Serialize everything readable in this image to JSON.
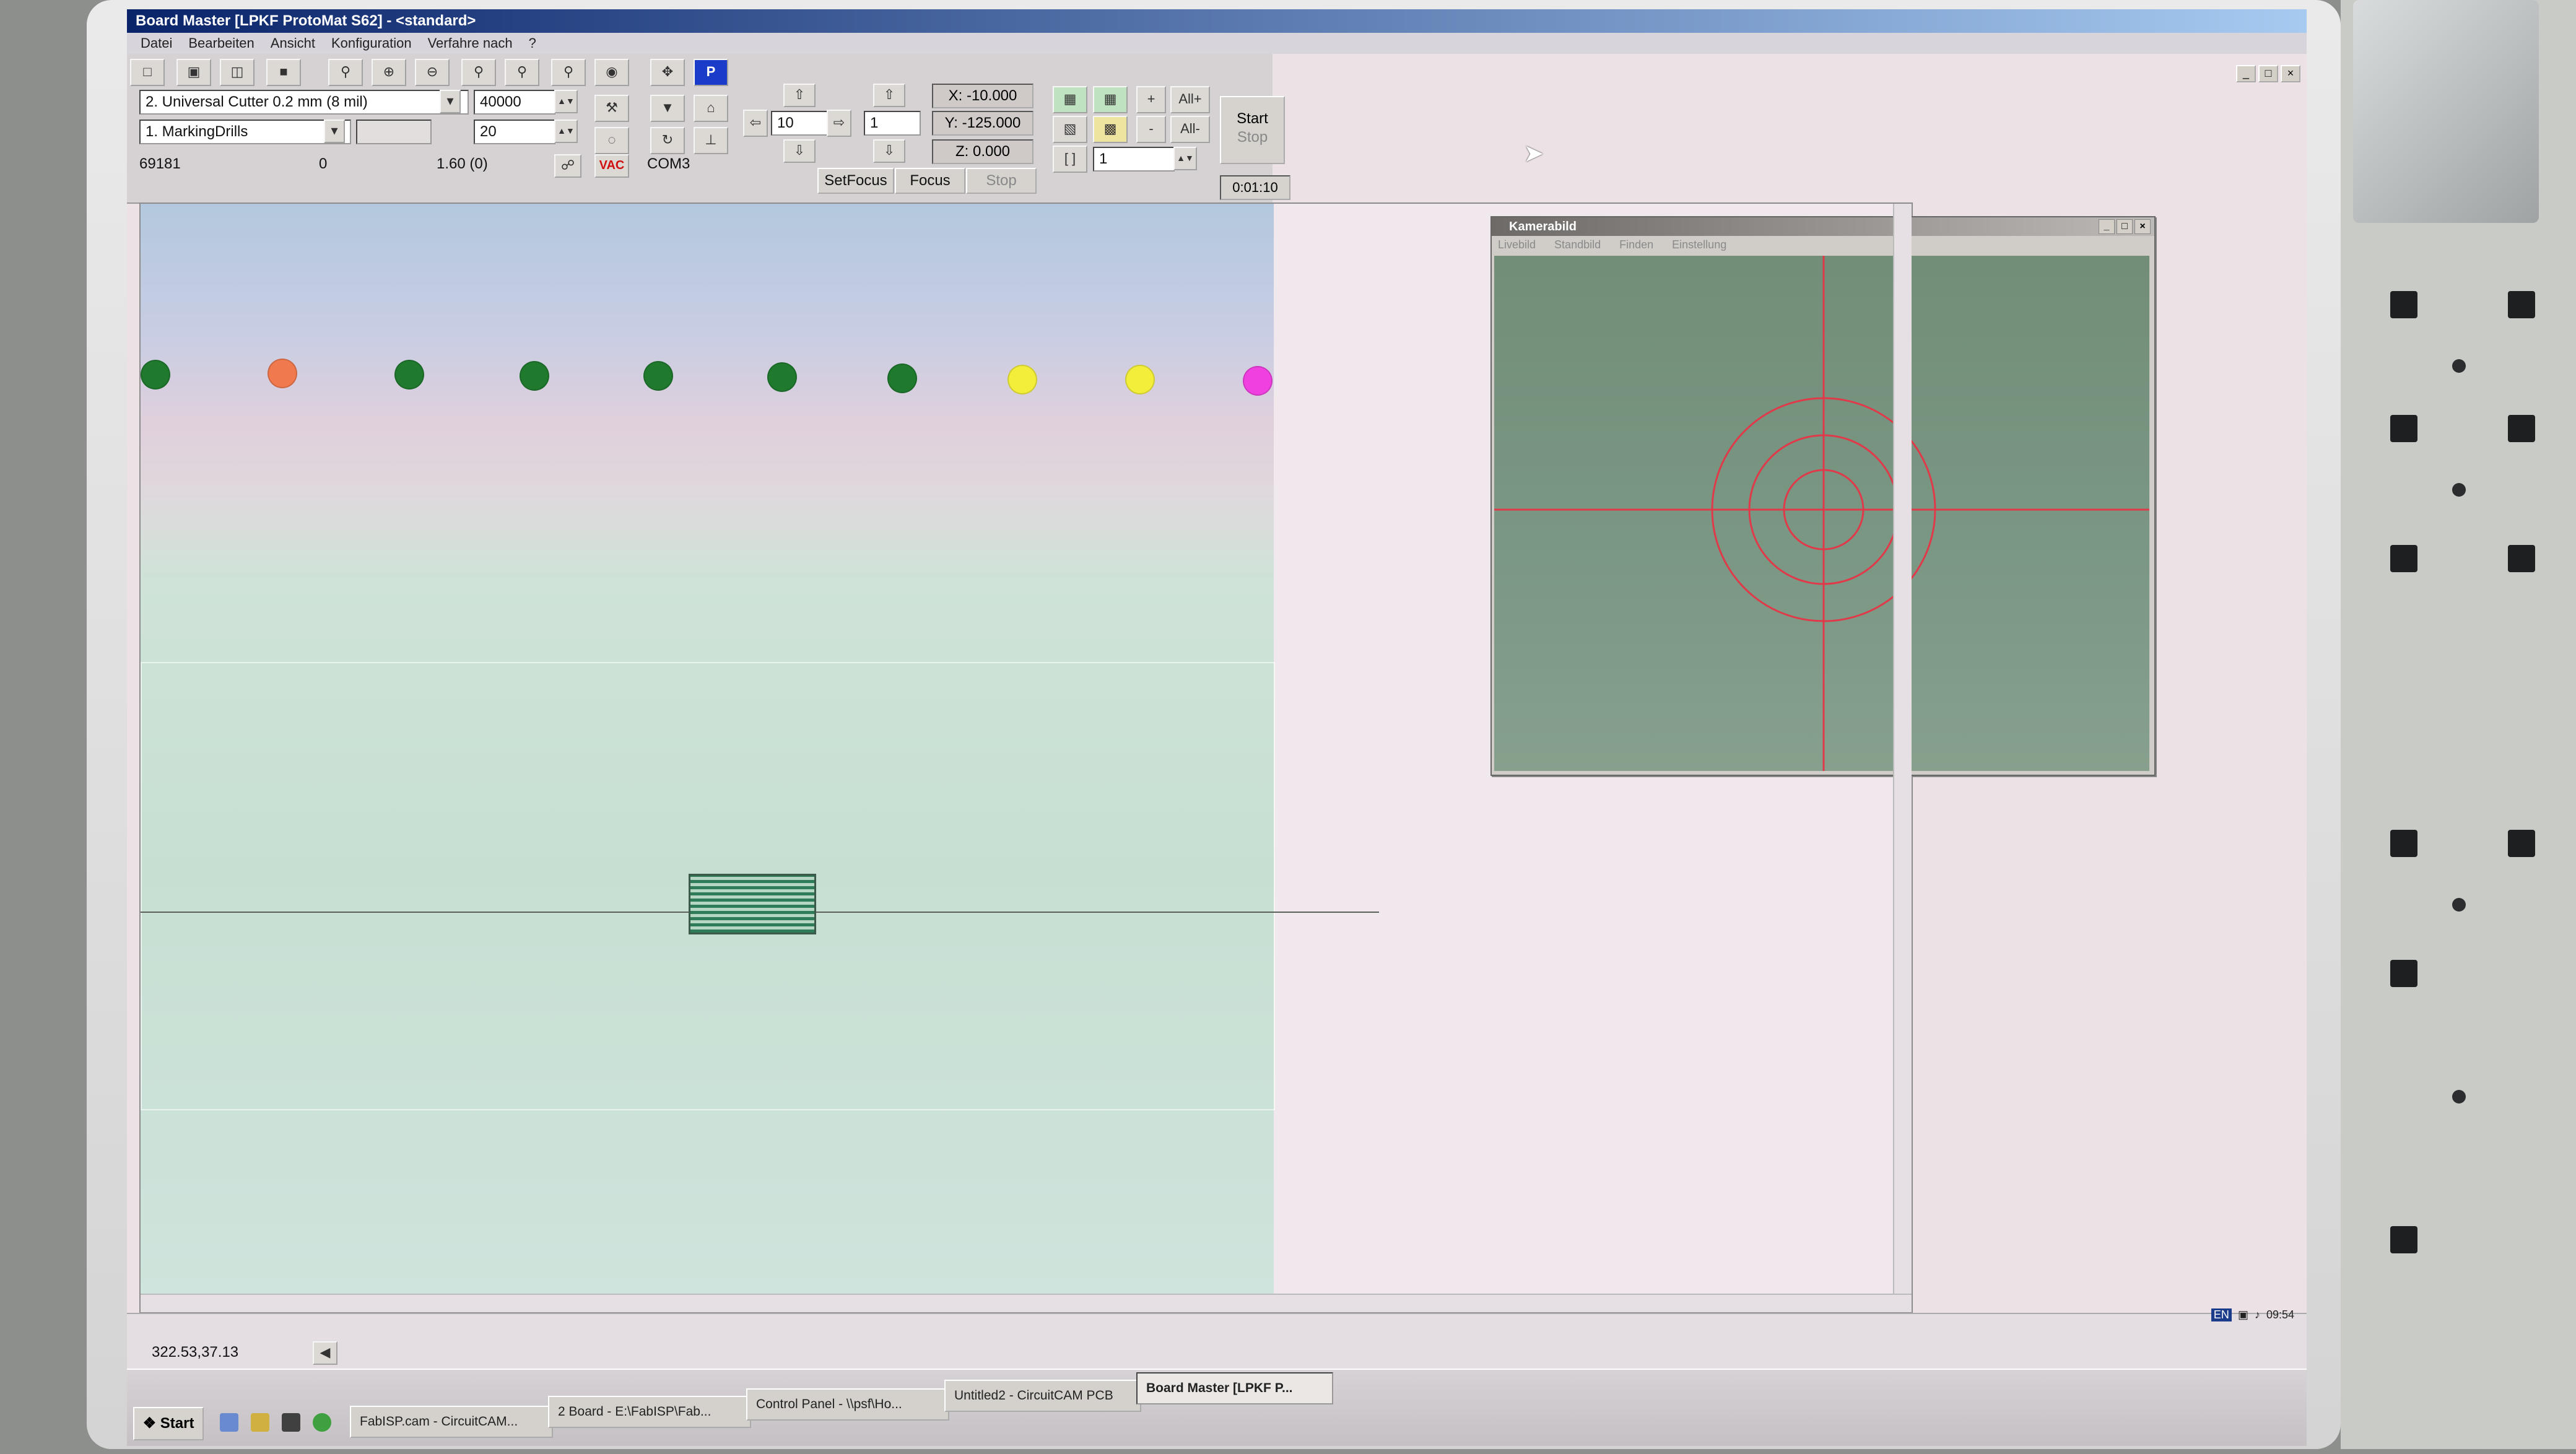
{
  "window": {
    "title": "Board Master [LPKF ProtoMat S62]  - <standard>"
  },
  "menu": [
    "Datei",
    "Bearbeiten",
    "Ansicht",
    "Konfiguration",
    "Verfahre nach",
    "?"
  ],
  "toolbar": {
    "tool_select": "2.  Universal Cutter 0.2 mm (8 mil)",
    "speed": "40000",
    "phase_select": "1.  MarkingDrills",
    "value_20": "20",
    "counter": "69181",
    "value_0": "0",
    "depth": "1.60 (0)",
    "vac_label": "VAC",
    "port": "COM3",
    "step_value": "10",
    "step_count": "1",
    "x_coord": "X: -10.000",
    "y_coord": "Y: -125.000",
    "z_coord": "Z: 0.000",
    "setfocus_label": "SetFocus",
    "focus_label": "Focus",
    "stop_label": "Stop",
    "all_plus": "All+",
    "all_minus": "All-",
    "plus": "+",
    "minus": "-",
    "loop_value": "1",
    "start_label": "Start",
    "startstop_stop_label": "Stop",
    "elapsed_time": "0:01:10",
    "p_label": "P"
  },
  "tool_magazine": {
    "colors": [
      "#1f7a2e",
      "#f07a4e",
      "#1f7a2e",
      "#1f7a2e",
      "#1f7a2e",
      "#1f7a2e",
      "#1f7a2e",
      "#f2ee3a",
      "#f2ee3a",
      "#f040e0"
    ]
  },
  "camera_window": {
    "title": "Kamerabild",
    "menu": [
      "Livebild",
      "Standbild",
      "Finden",
      "Einstellung"
    ]
  },
  "statusbar": {
    "coordinates": "322.53,37.13"
  },
  "taskbar": {
    "start_label": "Start",
    "tasks": [
      {
        "label": "FabISP.cam - CircuitCAM...",
        "active": false
      },
      {
        "label": "2 Board - E:\\FabISP\\Fab...",
        "active": false
      },
      {
        "label": "Control Panel - \\\\psf\\Ho...",
        "active": false
      },
      {
        "label": "Untitled2 - CircuitCAM PCB",
        "active": false
      },
      {
        "label": "Board Master [LPKF P...",
        "active": true
      }
    ],
    "tray_lang": "EN",
    "tray_time": "09:54"
  }
}
